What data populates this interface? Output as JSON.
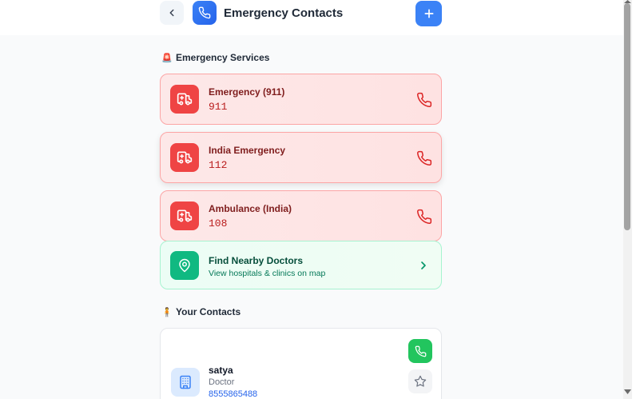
{
  "header": {
    "title": "Emergency Contacts"
  },
  "sections": {
    "emergency_services": {
      "emoji": "🚨",
      "label": "Emergency Services"
    },
    "your_contacts": {
      "emoji": "🧍",
      "label": "Your Contacts"
    }
  },
  "services": [
    {
      "name": "Emergency (911)",
      "number": "911"
    },
    {
      "name": "India Emergency",
      "number": "112"
    },
    {
      "name": "Ambulance (India)",
      "number": "108"
    }
  ],
  "nearby": {
    "title": "Find Nearby Doctors",
    "subtitle": "View hospitals & clinics on map"
  },
  "contacts": [
    {
      "name": "satya",
      "role": "Doctor",
      "phone": "8555865488"
    }
  ],
  "colors": {
    "accent": "#3b82f6",
    "danger": "#ef4444",
    "success": "#10b981",
    "call_green": "#22c55e"
  },
  "icons": {
    "back": "chevron-left-icon",
    "title": "phone-icon",
    "add": "plus-icon",
    "service": "ambulance-icon",
    "call": "phone-icon",
    "nearby": "map-pin-icon",
    "nearby_go": "chevron-right-icon",
    "contact_avatar": "building-icon",
    "favorite": "star-icon"
  }
}
